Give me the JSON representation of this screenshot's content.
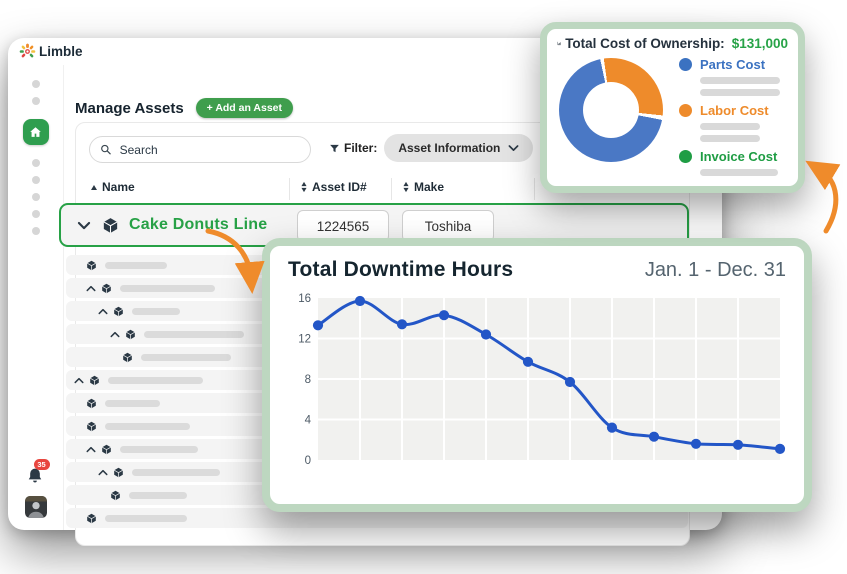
{
  "brand": {
    "name": "Limble"
  },
  "page": {
    "title": "Manage Assets",
    "add_button": "+ Add an Asset"
  },
  "toolbar": {
    "search_placeholder": "Search",
    "filter_label": "Filter:",
    "filter_value": "Asset Information"
  },
  "table": {
    "columns": [
      {
        "label": "Name",
        "sort": "asc"
      },
      {
        "label": "Asset ID#",
        "sort": "both"
      },
      {
        "label": "Make",
        "sort": "both"
      }
    ],
    "selected_row": {
      "name": "Cake Donuts Line",
      "asset_id": "1224565",
      "make": "Toshiba"
    },
    "skeleton_rows": [
      {
        "indent": 1,
        "chevron": false,
        "bar": 62
      },
      {
        "indent": 1,
        "chevron": true,
        "bar": 95
      },
      {
        "indent": 2,
        "chevron": true,
        "bar": 48
      },
      {
        "indent": 3,
        "chevron": true,
        "bar": 100
      },
      {
        "indent": 4,
        "chevron": false,
        "bar": 90
      },
      {
        "indent": 0,
        "chevron": true,
        "bar": 95
      },
      {
        "indent": 1,
        "chevron": false,
        "bar": 55
      },
      {
        "indent": 1,
        "chevron": false,
        "bar": 85
      },
      {
        "indent": 1,
        "chevron": true,
        "bar": 78
      },
      {
        "indent": 2,
        "chevron": true,
        "bar": 88
      },
      {
        "indent": 3,
        "chevron": false,
        "bar": 58
      },
      {
        "indent": 1,
        "chevron": false,
        "bar": 82
      }
    ]
  },
  "sidebar": {
    "nav_dots_top": 2,
    "nav_dots_bottom": 5,
    "notification_count": "35"
  },
  "cost_card": {
    "title": "Total Cost of Ownership:",
    "amount": "$131,000",
    "legend": [
      {
        "label": "Parts Cost",
        "color": "#3b72c1",
        "bars": [
          80,
          80
        ]
      },
      {
        "label": "Labor Cost",
        "color": "#ee8b2b",
        "bars": [
          60,
          60
        ]
      },
      {
        "label": "Invoice Cost",
        "color": "#1f9d44",
        "bars": [
          78
        ]
      }
    ],
    "donut": {
      "from_deg": -12,
      "segments": [
        {
          "name": "gap",
          "color": "#ffffff",
          "deg": 4
        },
        {
          "name": "labor-cost",
          "color": "#ee8b2b",
          "deg": 104
        },
        {
          "name": "gap",
          "color": "#ffffff",
          "deg": 5
        },
        {
          "name": "parts-cost",
          "color": "#4a78c5",
          "deg": 247
        }
      ],
      "approx_share_pct": {
        "parts": 69,
        "labor": 29,
        "invoice": 2
      }
    }
  },
  "chart_data": {
    "type": "line",
    "title": "Total Downtime Hours",
    "period": "Jan. 1 - Dec. 31",
    "x_points": 12,
    "x_tick_labels": [],
    "values": [
      13.3,
      15.7,
      13.4,
      14.3,
      12.4,
      9.7,
      7.7,
      3.2,
      2.3,
      1.6,
      1.5,
      1.1
    ],
    "ylim": [
      0,
      16
    ],
    "yticks": [
      0,
      4,
      8,
      12,
      16
    ],
    "grid": true,
    "line_color": "#2356c7"
  },
  "colors": {
    "accent_green": "#27a146",
    "sage_border": "#bdd7c0",
    "plot_bg": "#f1f1ef",
    "arrow_orange": "#ef8b2b",
    "skeleton_gray": "#dbdbdb",
    "badge_red": "#e8463f"
  },
  "icons": [
    "limble-gear-logo",
    "home-icon",
    "bell-icon",
    "search-icon",
    "funnel-icon",
    "chevron-down-icon",
    "chevron-up-icon",
    "asset-cube-icon",
    "sort-asc-icon",
    "sort-both-icon",
    "bar-chart-icon",
    "curved-arrow"
  ]
}
